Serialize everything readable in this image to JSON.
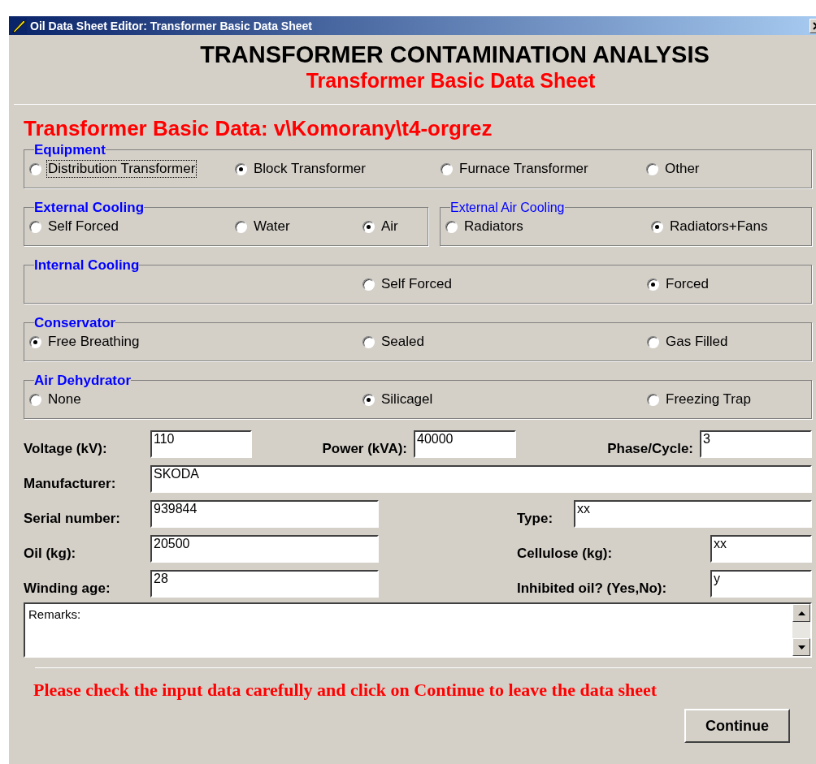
{
  "window": {
    "title": "Oil Data Sheet Editor: Transformer Basic Data Sheet"
  },
  "heading": "TRANSFORMER CONTAMINATION ANALYSIS",
  "subheading": "Transformer Basic Data Sheet",
  "data_title": "Transformer Basic Data: v\\Komorany\\t4-orgrez",
  "group_rows": [
    [
      {
        "title": "Equipment",
        "kind": "bold",
        "options": [
          {
            "label": "Distribution Transformer",
            "selected": false,
            "focused": true
          },
          {
            "label": "Block Transformer",
            "selected": true,
            "focused": false
          },
          {
            "label": "Furnace Transformer",
            "selected": false,
            "focused": false
          },
          {
            "label": "Other",
            "selected": false,
            "focused": false
          }
        ]
      }
    ],
    [
      {
        "title": "External Cooling",
        "kind": "bold",
        "options": [
          {
            "label": "Self Forced",
            "selected": false,
            "focused": false
          },
          {
            "label": "Water",
            "selected": false,
            "focused": false
          },
          {
            "label": "Air",
            "selected": true,
            "focused": false
          }
        ]
      },
      {
        "title": "External Air Cooling",
        "kind": "plain",
        "options": [
          {
            "label": "Radiators",
            "selected": false,
            "focused": false
          },
          {
            "label": "Radiators+Fans",
            "selected": true,
            "focused": false
          }
        ]
      }
    ],
    [
      {
        "title": "Internal Cooling",
        "kind": "bold",
        "options": [
          {
            "label": "Self Forced",
            "selected": false,
            "focused": false
          },
          {
            "label": "Forced",
            "selected": true,
            "focused": false
          }
        ]
      }
    ],
    [
      {
        "title": "Conservator",
        "kind": "bold",
        "options": [
          {
            "label": "Free Breathing",
            "selected": true,
            "focused": false
          },
          {
            "label": "Sealed",
            "selected": false,
            "focused": false
          },
          {
            "label": "Gas Filled",
            "selected": false,
            "focused": false
          }
        ]
      }
    ],
    [
      {
        "title": "Air Dehydrator",
        "kind": "bold",
        "options": [
          {
            "label": "None",
            "selected": false,
            "focused": false
          },
          {
            "label": "Silicagel",
            "selected": true,
            "focused": false
          },
          {
            "label": "Freezing Trap",
            "selected": false,
            "focused": false
          }
        ]
      }
    ]
  ],
  "field_rows": [
    [
      {
        "label": "Voltage (kV):",
        "value": "110"
      },
      {
        "label": "Power (kVA):",
        "value": "40000"
      },
      {
        "label": "Phase/Cycle:",
        "value": "3"
      }
    ],
    [
      {
        "label": "Manufacturer:",
        "value": "SKODA"
      }
    ],
    [
      {
        "label": "Serial number:",
        "value": "939844"
      },
      {
        "label": "Type:",
        "value": "xx"
      }
    ],
    [
      {
        "label": "Oil (kg):",
        "value": "20500"
      },
      {
        "label": "Cellulose (kg):",
        "value": "xx"
      }
    ],
    [
      {
        "label": "Winding age:",
        "value": "28"
      },
      {
        "label": "Inhibited oil? (Yes,No):",
        "value": "y"
      }
    ]
  ],
  "remarks": {
    "value": "Remarks:"
  },
  "notice": "Please check the input data carefully and click on Continue to leave the data sheet",
  "buttons": [
    "Continue"
  ]
}
